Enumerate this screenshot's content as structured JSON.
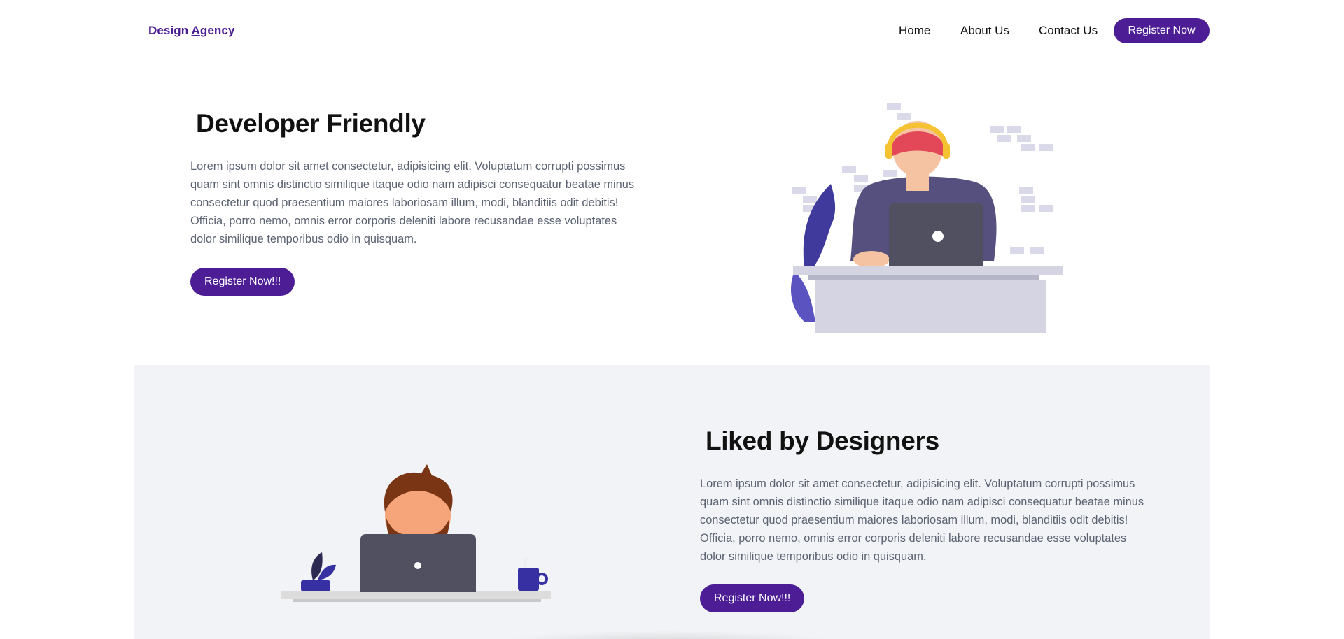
{
  "nav": {
    "brand_first": "Design ",
    "brand_letter": "A",
    "brand_rest": "gency",
    "home": "Home",
    "about": "About Us",
    "contact": "Contact Us",
    "register": "Register Now"
  },
  "section1": {
    "title": "Developer Friendly",
    "paragraph": "Lorem ipsum dolor sit amet consectetur, adipisicing elit. Voluptatum corrupti possimus quam sint omnis distinctio similique itaque odio nam adipisci consequatur beatae minus consectetur quod praesentium maiores laboriosam illum, modi, blanditiis odit debitis! Officia, porro nemo, omnis error corporis deleniti labore recusandae esse voluptates dolor similique temporibus odio in quisquam.",
    "cta": "Register Now!!!"
  },
  "section2": {
    "title": "Liked by Designers",
    "paragraph": "Lorem ipsum dolor sit amet consectetur, adipisicing elit. Voluptatum corrupti possimus quam sint omnis distinctio similique itaque odio nam adipisci consequatur beatae minus consectetur quod praesentium maiores laboriosam illum, modi, blanditiis odit debitis! Officia, porro nemo, omnis error corporis deleniti labore recusandae esse voluptates dolor similique temporibus odio in quisquam.",
    "cta": "Register Now!!!"
  },
  "colors": {
    "accent": "#4c1d95",
    "text_muted": "#5b6272",
    "section_bg": "#f2f3f6"
  },
  "icons": {
    "illustration1": "developer-with-headphones-illustration",
    "illustration2": "designer-at-laptop-illustration"
  }
}
